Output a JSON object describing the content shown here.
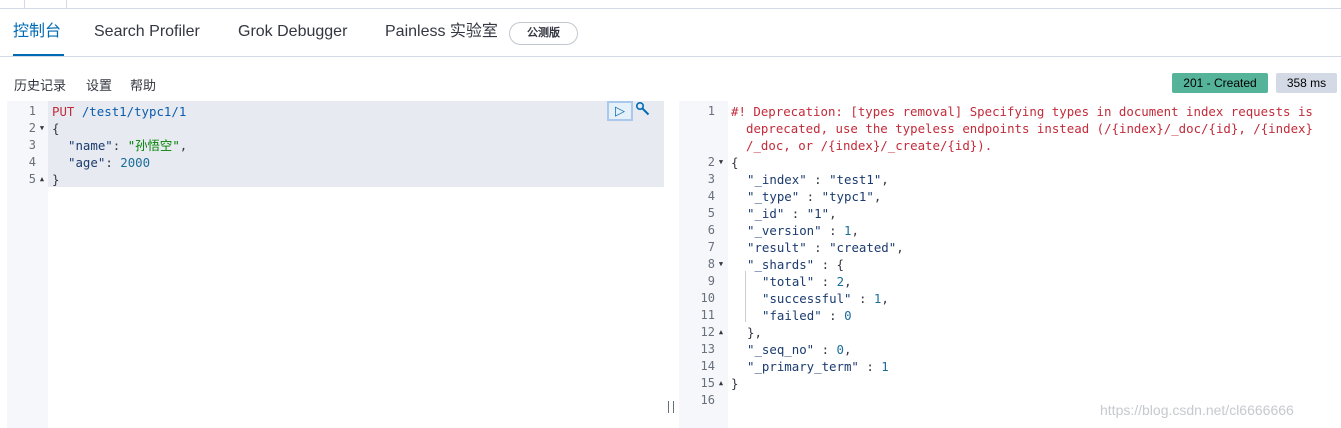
{
  "tabs": [
    {
      "label": "控制台",
      "active": true
    },
    {
      "label": "Search Profiler",
      "active": false
    },
    {
      "label": "Grok Debugger",
      "active": false
    },
    {
      "label": "Painless 实验室",
      "active": false
    }
  ],
  "beta_badge": "公测版",
  "toolbar": {
    "history": "历史记录",
    "settings": "设置",
    "help": "帮助"
  },
  "response_status": "201 - Created",
  "response_time": "358 ms",
  "request_editor": {
    "line_numbers": [
      "1",
      "2",
      "3",
      "4",
      "5"
    ],
    "lines": {
      "l1": {
        "method": "PUT",
        "path": " /test1/typc1/1"
      },
      "l2": "{",
      "l3": {
        "key": "\"name\"",
        "sep": ": ",
        "value": "\"孙悟空\"",
        "tail": ","
      },
      "l4": {
        "key": "\"age\"",
        "sep": ": ",
        "value": "2000"
      },
      "l5": "}"
    }
  },
  "response_editor": {
    "line_numbers": [
      "1",
      "2",
      "3",
      "4",
      "5",
      "6",
      "7",
      "8",
      "9",
      "10",
      "11",
      "12",
      "13",
      "14",
      "15",
      "16"
    ],
    "warning_lines": [
      "#! Deprecation: [types removal] Specifying types in document index requests is",
      "deprecated, use the typeless endpoints instead (/{index}/_doc/{id}, /{index}",
      "/_doc, or /{index}/_create/{id})."
    ],
    "lines": {
      "open": "{",
      "index": {
        "key": "\"_index\"",
        "value": "\"test1\""
      },
      "type": {
        "key": "\"_type\"",
        "value": "\"typc1\""
      },
      "id": {
        "key": "\"_id\"",
        "value": "\"1\""
      },
      "version": {
        "key": "\"_version\"",
        "value": "1"
      },
      "result": {
        "key": "\"result\"",
        "value": "\"created\""
      },
      "shards": {
        "key": "\"_shards\"",
        "value": "{"
      },
      "total": {
        "key": "\"total\"",
        "value": "2"
      },
      "successful": {
        "key": "\"successful\"",
        "value": "1"
      },
      "failed": {
        "key": "\"failed\"",
        "value": "0"
      },
      "shards_close": "},",
      "seq_no": {
        "key": "\"_seq_no\"",
        "value": "0"
      },
      "primary_term": {
        "key": "\"_primary_term\"",
        "value": "1"
      },
      "close": "}"
    }
  },
  "actions": {
    "run_icon": "play-icon",
    "settings_icon": "wrench-icon"
  },
  "watermark": "https://blog.csdn.net/cl6666666",
  "colors": {
    "accent": "#006bb4",
    "status_success": "#54b399",
    "warning_text": "#c22b3a"
  }
}
